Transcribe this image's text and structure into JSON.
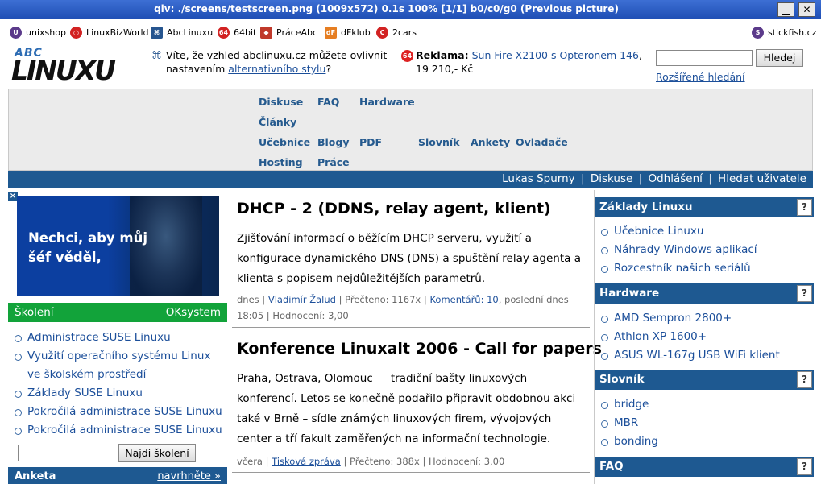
{
  "window": {
    "title": "qiv: ./screens/testscreen.png (1009x572) 0.1s 100% [1/1] b0/c0/g0 (Previous picture)",
    "minimize": "▁",
    "close": "✕"
  },
  "bookmarks": [
    {
      "label": "unixshop",
      "icon": "unixshop-icon",
      "color": "#5b3a8a",
      "glyph": "U"
    },
    {
      "label": "LinuxBizWorld",
      "icon": "linuxbizworld-icon",
      "color": "#d22222",
      "glyph": "○"
    },
    {
      "label": "AbcLinuxu",
      "icon": "abclinuxu-icon",
      "color": "#26558f",
      "glyph": "⌘"
    },
    {
      "label": "64bit",
      "icon": "64bit-icon",
      "color": "#d22222",
      "glyph": "64"
    },
    {
      "label": "PráceAbc",
      "icon": "praceabc-icon",
      "color": "#c0392b",
      "glyph": "◆"
    },
    {
      "label": "dFklub",
      "icon": "dfklub-icon",
      "color": "#e67e22",
      "glyph": "dF"
    },
    {
      "label": "2cars",
      "icon": "2cars-icon",
      "color": "#d22222",
      "glyph": "C"
    },
    {
      "label": "stickfish.cz",
      "icon": "stickfish-icon",
      "color": "#5b3a8a",
      "glyph": "S"
    }
  ],
  "logo": {
    "abc": "ABC",
    "linux": "LINUXU"
  },
  "tip": {
    "text_before": "Víte, že vzhled abclinuxu.cz můžete ovlivnit nastavením ",
    "link": "alternativního stylu",
    "text_after": "?"
  },
  "ad": {
    "label": "Reklama:",
    "link": "Sun Fire X2100 s Opteronem 146",
    "suffix": ",",
    "price": "19 210,- Kč",
    "icon_glyph": "64"
  },
  "search": {
    "value": "",
    "button": "Hledej",
    "advanced": "Rozšířené hledání"
  },
  "nav": {
    "diskuse": "Diskuse",
    "faq": "FAQ",
    "hardware": "Hardware",
    "clanky": "Články",
    "ucebnice": "Učebnice",
    "blogy": "Blogy",
    "pdf": "PDF",
    "slovnik": "Slovník",
    "ankety": "Ankety",
    "ovladace": "Ovladače",
    "hosting": "Hosting",
    "prace": "Práce"
  },
  "userbar": {
    "user": "Lukas Spurny",
    "diskuse": "Diskuse",
    "odhlaseni": "Odhlášení",
    "hledat": "Hledat uživatele",
    "sep": "|"
  },
  "banner": {
    "close": "×",
    "line1": "Nechci, aby můj",
    "line2": "šéf věděl,"
  },
  "skoleni": {
    "title": "Školení",
    "sponsor": "OKsystem",
    "items": [
      "Administrace SUSE Linuxu",
      "Využití operačního systému Linux ve školském prostředí",
      "Základy SUSE Linuxu",
      "Pokročilá administrace SUSE Linuxu",
      "Pokročilá administrace SUSE Linuxu"
    ],
    "input_value": "",
    "button": "Najdi školení"
  },
  "anketa": {
    "title": "Anketa",
    "link": "navrhněte »"
  },
  "articles": [
    {
      "title": "DHCP - 2 (DDNS, relay agent, klient)",
      "perex": "Zjišťování informací o běžícím DHCP serveru, využití a konfigurace dynamického DNS (DNS) a spuštění relay agenta a klienta s popisem nejdůležitějších parametrů.",
      "date": "dnes",
      "author": "Vladimír Žalud",
      "read": "Přečteno: 1167x",
      "comments": "Komentářů: 10",
      "last": ", poslední dnes 18:05",
      "rating": "Hodnocení: 3,00"
    },
    {
      "title": "Konference Linuxalt 2006 - Call for papers",
      "perex": "Praha, Ostrava, Olomouc — tradiční bašty linuxových konferencí. Letos se konečně podařilo připravit obdobnou akci také v Brně – sídle známých linuxových firem, vývojových center a tří fakult zaměřených na informační technologie.",
      "date": "včera",
      "author": "Tisková zpráva",
      "read": "Přečteno: 388x",
      "rating": "Hodnocení: 3,00"
    }
  ],
  "right": {
    "zaklady": {
      "title": "Základy Linuxu",
      "items": [
        "Učebnice Linuxu",
        "Náhrady Windows aplikací",
        "Rozcestník našich seriálů"
      ]
    },
    "hardware": {
      "title": "Hardware",
      "items": [
        "AMD Sempron 2800+",
        "Athlon XP 1600+",
        "ASUS WL-167g USB WiFi klient"
      ]
    },
    "slovnik": {
      "title": "Slovník",
      "items": [
        "bridge",
        "MBR",
        "bonding"
      ]
    },
    "faq": {
      "title": "FAQ"
    },
    "help": "?"
  }
}
